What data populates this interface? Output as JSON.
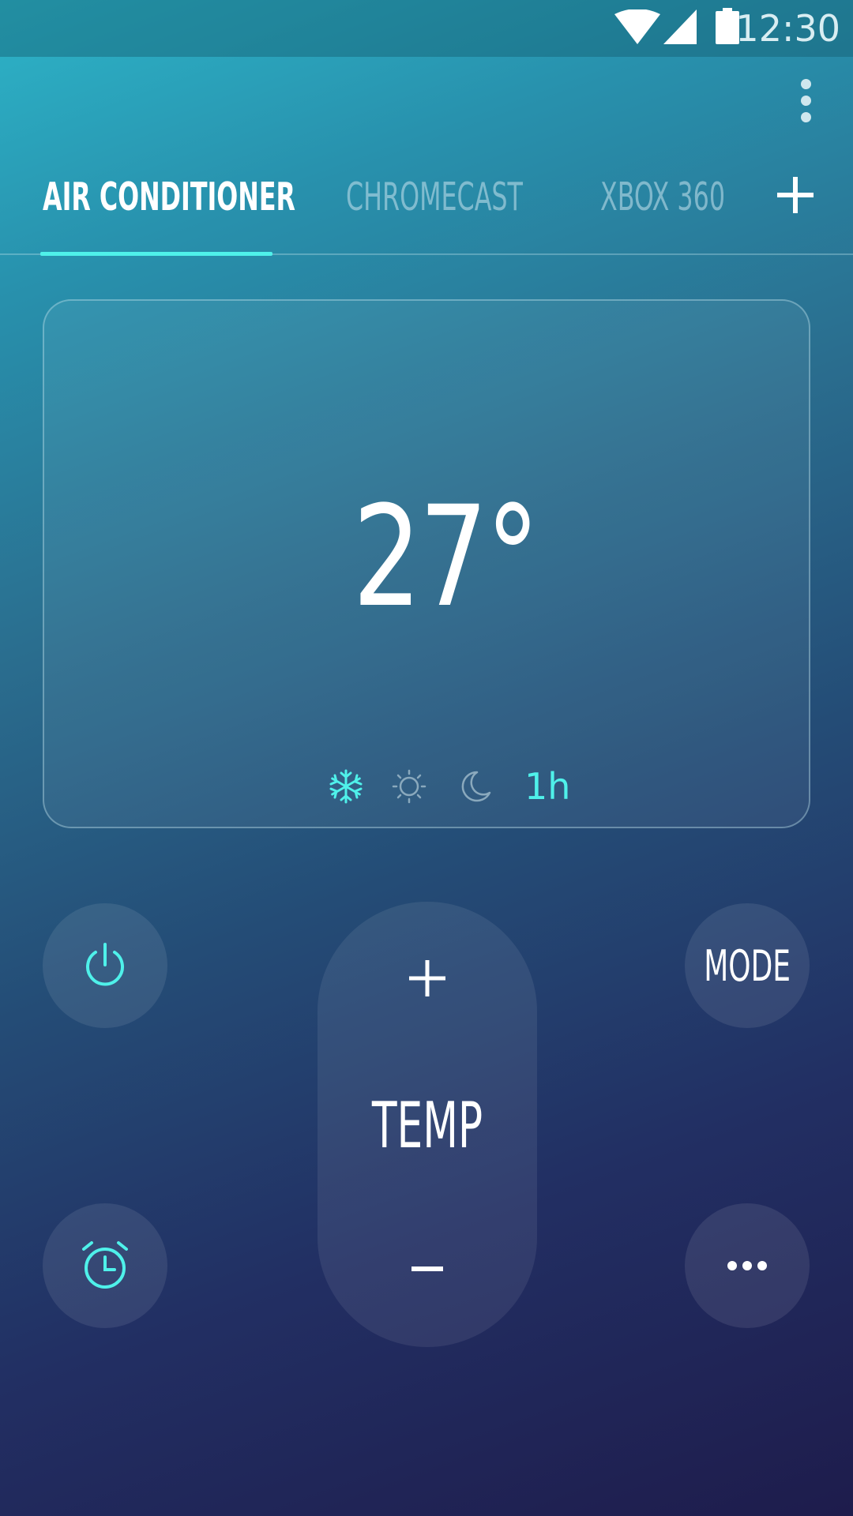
{
  "status_bar": {
    "time": "12:30",
    "icons": [
      "wifi-icon",
      "cell-signal-icon",
      "battery-icon"
    ]
  },
  "toolbar": {
    "overflow_icon": "more-vertical-icon"
  },
  "tabs": [
    {
      "label": "AIR CONDITIONER",
      "active": true
    },
    {
      "label": "CHROMECAST",
      "active": false
    },
    {
      "label": "XBOX 360",
      "active": false
    }
  ],
  "add_tab_icon": "plus-icon",
  "display": {
    "temperature": "27°",
    "modes": [
      {
        "icon": "snowflake-icon",
        "active": true
      },
      {
        "icon": "sun-icon",
        "active": false
      },
      {
        "icon": "moon-icon",
        "active": false
      }
    ],
    "timer": "1h"
  },
  "controls": {
    "power_icon": "power-icon",
    "mode_label": "MODE",
    "temp_label": "TEMP",
    "increase_icon": "plus-icon",
    "decrease_icon": "minus-icon",
    "timer_icon": "alarm-clock-icon",
    "more_icon": "more-horizontal-icon"
  },
  "colors": {
    "accent": "#4ff1ea",
    "gradient_top": "#2db4c8",
    "gradient_bottom": "#1e1c4c",
    "inactive_icon": "#8aa9bd"
  }
}
